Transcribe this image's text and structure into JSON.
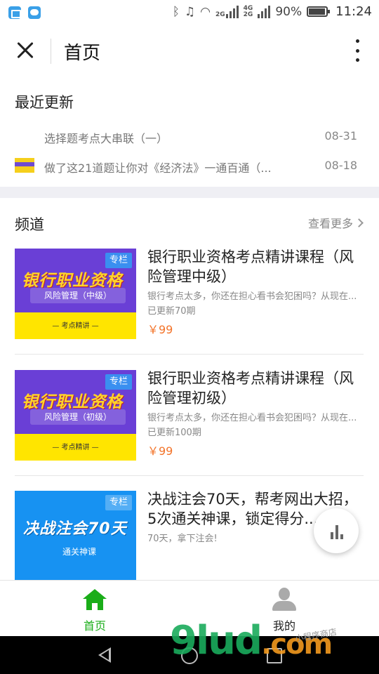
{
  "status_bar": {
    "battery": "90%",
    "time": "11:24",
    "net_2g": "2G",
    "net_4g": "4G",
    "net_2g_b": "2G",
    "icons": [
      "gallery-icon",
      "message-icon",
      "bluetooth-icon",
      "mute-icon",
      "wifi-icon",
      "signal-icon",
      "battery-icon"
    ]
  },
  "header": {
    "title": "首页"
  },
  "recent": {
    "title": "最近更新",
    "items": [
      {
        "title": "选择题考点大串联（一）",
        "date": "08-31"
      },
      {
        "title": "做了这21道题让你对《经济法》一通百通（...",
        "date": "08-18"
      }
    ]
  },
  "channel": {
    "title": "频道",
    "see_more": "查看更多",
    "courses": [
      {
        "cover_big": "银行职业资格",
        "cover_sub": "风险管理（中级）",
        "cover_band": "— 考点精讲 —",
        "tag": "专栏",
        "title": "银行职业资格考点精讲课程（风险管理中级）",
        "desc": "银行考点太多，你还在担心看书会犯困吗？从现在...",
        "updated": "已更新70期",
        "price": "￥99"
      },
      {
        "cover_big": "银行职业资格",
        "cover_sub": "风险管理（初级）",
        "cover_band": "— 考点精讲 —",
        "tag": "专栏",
        "title": "银行职业资格考点精讲课程（风险管理初级）",
        "desc": "银行考点太多，你还在担心看书会犯困吗？从现在...",
        "updated": "已更新100期",
        "price": "￥99"
      },
      {
        "cover_big": "决战注会70天",
        "cover_sub": "通关神课",
        "tag": "专栏",
        "title": "决战注会70天，帮考网出大招，5次通关神课，锁定得分...",
        "desc": "70天，拿下注会!"
      }
    ]
  },
  "tabbar": {
    "home": "首页",
    "me": "我的"
  },
  "watermark": {
    "brand": "9lud",
    "domain": ".com",
    "small": "小程序商店"
  },
  "colors": {
    "accent_green": "#1aad19",
    "price_orange": "#f3742a",
    "cover_purple": "#6a3fd6",
    "cover_blue": "#1792f2"
  }
}
